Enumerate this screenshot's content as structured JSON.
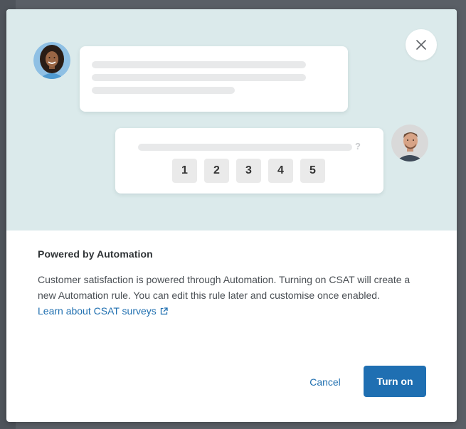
{
  "dialog": {
    "close_icon": "close-icon",
    "heading": "Powered by Automation",
    "description": "Customer satisfaction is powered through Automation. Turning on CSAT will create a new Automation rule. You can edit this rule later and customise once enabled.",
    "learn_link": "Learn about CSAT surveys",
    "learn_link_icon": "external-link-icon",
    "cancel_label": "Cancel",
    "confirm_label": "Turn on",
    "confirm_color": "#1f6fb2",
    "link_color": "#1f6fb0"
  },
  "illustration": {
    "background_color": "#dbeaeb",
    "question_mark": "?",
    "rating_options": [
      "1",
      "2",
      "3",
      "4",
      "5"
    ]
  }
}
